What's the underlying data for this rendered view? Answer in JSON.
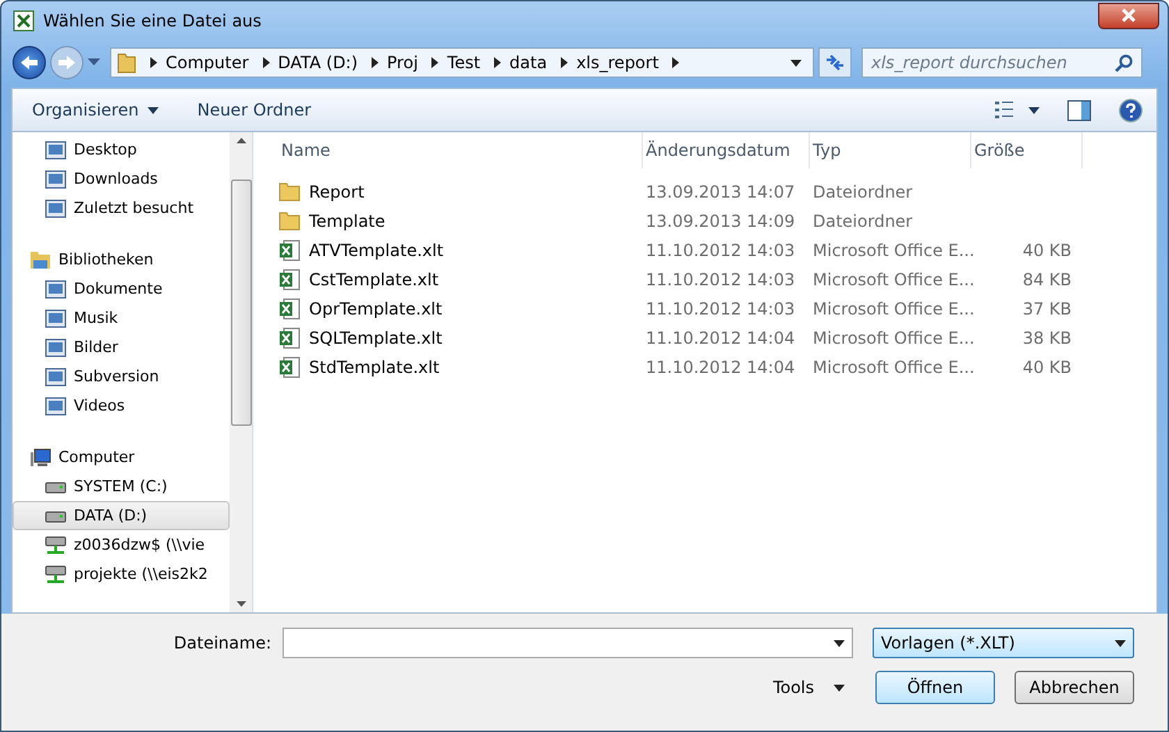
{
  "window": {
    "title": "Wählen Sie eine Datei aus"
  },
  "breadcrumb": [
    "Computer",
    "DATA (D:)",
    "Proj",
    "Test",
    "data",
    "xls_report"
  ],
  "search": {
    "placeholder": "xls_report durchsuchen"
  },
  "toolbar": {
    "organize": "Organisieren",
    "new_folder": "Neuer Ordner"
  },
  "sidebar": {
    "groups": [
      {
        "items": [
          {
            "label": "Desktop",
            "selected": false
          },
          {
            "label": "Downloads",
            "selected": false
          },
          {
            "label": "Zuletzt besucht",
            "selected": false
          }
        ]
      },
      {
        "label": "Bibliotheken",
        "items": [
          {
            "label": "Dokumente",
            "selected": false
          },
          {
            "label": "Musik",
            "selected": false
          },
          {
            "label": "Bilder",
            "selected": false
          },
          {
            "label": "Subversion",
            "selected": false
          },
          {
            "label": "Videos",
            "selected": false
          }
        ]
      },
      {
        "label": "Computer",
        "items": [
          {
            "label": "SYSTEM (C:)",
            "selected": false
          },
          {
            "label": "DATA (D:)",
            "selected": true
          },
          {
            "label": "z0036dzw$ (\\\\vie",
            "selected": false
          },
          {
            "label": "projekte (\\\\eis2k2",
            "selected": false
          }
        ]
      }
    ]
  },
  "table": {
    "columns": [
      "Name",
      "Änderungsdatum",
      "Typ",
      "Größe"
    ],
    "rows": [
      {
        "kind": "folder",
        "name": "Report",
        "date": "13.09.2013 14:07",
        "type": "Dateiordner",
        "size": ""
      },
      {
        "kind": "folder",
        "name": "Template",
        "date": "13.09.2013 14:09",
        "type": "Dateiordner",
        "size": ""
      },
      {
        "kind": "file",
        "name": "ATVTemplate.xlt",
        "date": "11.10.2012 14:03",
        "type": "Microsoft Office E...",
        "size": "40 KB"
      },
      {
        "kind": "file",
        "name": "CstTemplate.xlt",
        "date": "11.10.2012 14:03",
        "type": "Microsoft Office E...",
        "size": "84 KB"
      },
      {
        "kind": "file",
        "name": "OprTemplate.xlt",
        "date": "11.10.2012 14:03",
        "type": "Microsoft Office E...",
        "size": "37 KB"
      },
      {
        "kind": "file",
        "name": "SQLTemplate.xlt",
        "date": "11.10.2012 14:04",
        "type": "Microsoft Office E...",
        "size": "38 KB"
      },
      {
        "kind": "file",
        "name": "StdTemplate.xlt",
        "date": "11.10.2012 14:04",
        "type": "Microsoft Office E...",
        "size": "40 KB"
      }
    ]
  },
  "footer": {
    "filename_label": "Dateiname:",
    "filter": "Vorlagen (*.XLT)",
    "tools": "Tools",
    "buttons": [
      "Öffnen",
      "Abbrechen"
    ]
  }
}
